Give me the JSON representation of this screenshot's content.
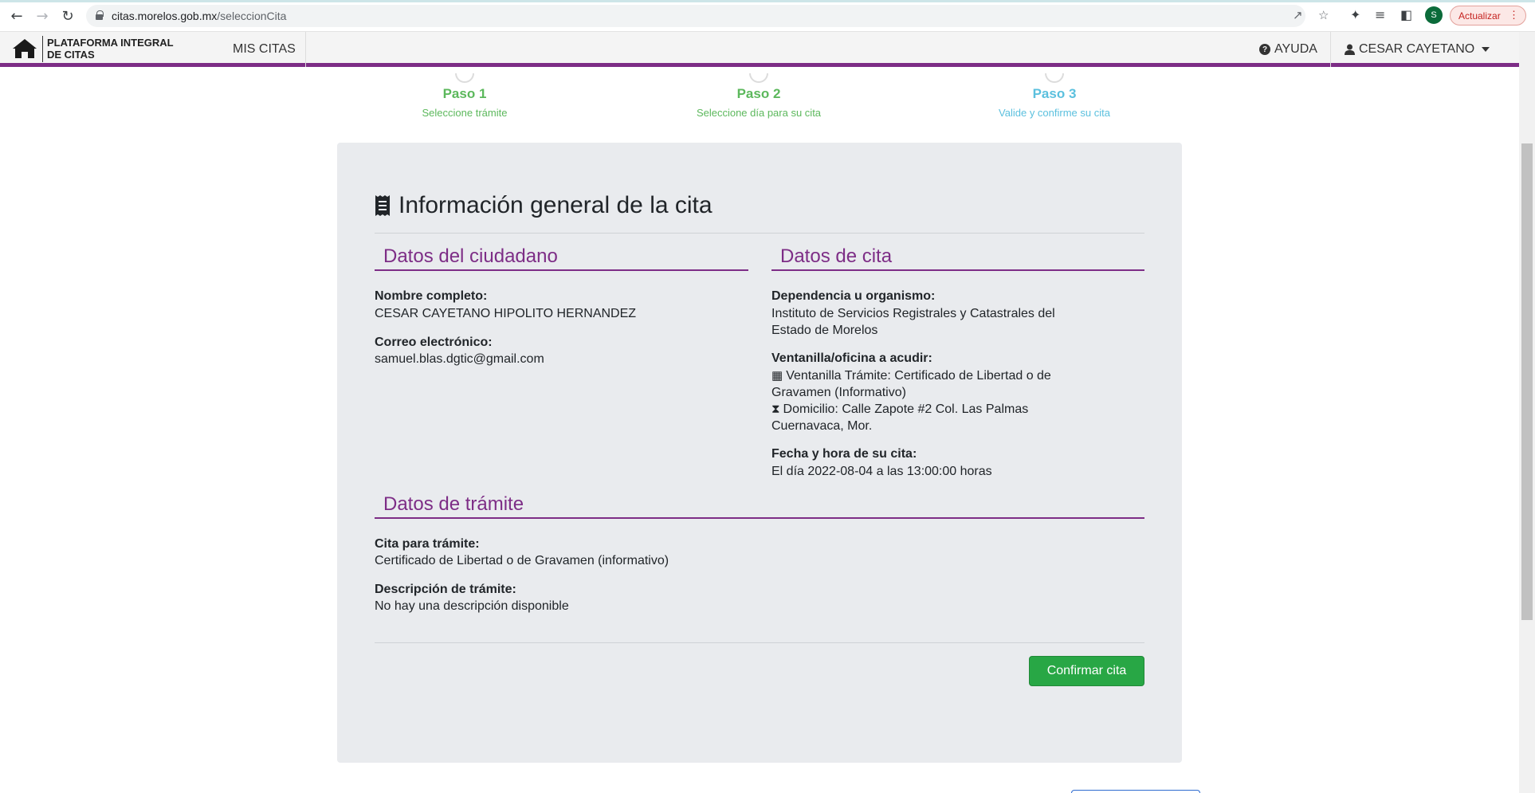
{
  "browser": {
    "url_host": "citas.morelos.gob.mx",
    "url_path": "/seleccionCita",
    "profile_initial": "S",
    "update_label": "Actualizar"
  },
  "header": {
    "brand_line1": "PLATAFORMA INTEGRAL",
    "brand_line2": "DE CITAS",
    "nav_mis_citas": "MIS CITAS",
    "nav_ayuda": "AYUDA",
    "user_name": "CESAR CAYETANO"
  },
  "steps": [
    {
      "title": "Paso 1",
      "subtitle": "Seleccione trámite",
      "color": "#5cb85c"
    },
    {
      "title": "Paso 2",
      "subtitle": "Seleccione día para su cita",
      "color": "#5cb85c"
    },
    {
      "title": "Paso 3",
      "subtitle": "Valide y confirme su cita",
      "color": "#5bc0de"
    }
  ],
  "card": {
    "title": "Información general de la cita",
    "ciudadano": {
      "heading": "Datos del ciudadano",
      "nombre_label": "Nombre completo:",
      "nombre_value": "CESAR CAYETANO HIPOLITO HERNANDEZ",
      "correo_label": "Correo electrónico:",
      "correo_value": "samuel.blas.dgtic@gmail.com"
    },
    "cita": {
      "heading": "Datos de cita",
      "dependencia_label": "Dependencia u organismo:",
      "dependencia_line1": "Instituto de Servicios Registrales y Catastrales del",
      "dependencia_line2": "Estado de Morelos",
      "ventanilla_label": "Ventanilla/oficina a acudir:",
      "ventanilla_line1": "Ventanilla Trámite: Certificado de Libertad o de",
      "ventanilla_line2": "Gravamen (Informativo)",
      "domicilio_line1": "Domicilio: Calle Zapote #2 Col. Las Palmas",
      "domicilio_line2": "Cuernavaca, Mor.",
      "fecha_label": "Fecha y hora de su cita:",
      "fecha_value": "El día 2022-08-04 a las 13:00:00 horas"
    },
    "tramite": {
      "heading": "Datos de trámite",
      "cita_label": "Cita para trámite:",
      "cita_value": "Certificado de Libertad o de Gravamen (informativo)",
      "descripcion_label": "Descripción de trámite:",
      "descripcion_value": "No hay una descripción disponible"
    },
    "confirm_label": "Confirmar cita"
  },
  "colors": {
    "accent_purple": "#7d2d86",
    "step_done_green": "#5cb85c",
    "step_current_blue": "#5bc0de",
    "confirm_green": "#28a745"
  }
}
